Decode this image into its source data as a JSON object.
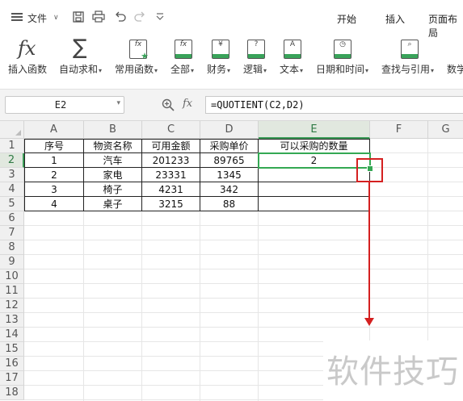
{
  "menubar": {
    "file_label": "文件",
    "tabs": [
      "开始",
      "插入",
      "页面布局"
    ]
  },
  "ribbon": {
    "items": [
      {
        "label": "插入函数",
        "icon": "fx-icon",
        "dropdown": false
      },
      {
        "label": "自动求和",
        "icon": "sigma-icon",
        "dropdown": true
      },
      {
        "label": "常用函数",
        "icon": "star-fx-icon",
        "dropdown": true
      },
      {
        "label": "全部",
        "icon": "fx-book-icon",
        "dropdown": true
      },
      {
        "label": "财务",
        "icon": "yen-book-icon",
        "dropdown": true
      },
      {
        "label": "逻辑",
        "icon": "question-book-icon",
        "dropdown": true
      },
      {
        "label": "文本",
        "icon": "a-book-icon",
        "dropdown": true
      },
      {
        "label": "日期和时间",
        "icon": "clock-book-icon",
        "dropdown": true
      },
      {
        "label": "查找与引用",
        "icon": "search-book-icon",
        "dropdown": true
      },
      {
        "label": "数学",
        "icon": "math-book-icon",
        "dropdown": false
      }
    ]
  },
  "formula_bar": {
    "name_box": "E2",
    "fx_label": "fx",
    "formula": "=QUOTIENT(C2,D2)"
  },
  "sheet": {
    "columns": [
      "A",
      "B",
      "C",
      "D",
      "E",
      "F",
      "G"
    ],
    "selected_column": "E",
    "rows": [
      "1",
      "2",
      "3",
      "4",
      "5",
      "6",
      "7",
      "8",
      "9",
      "10",
      "11",
      "12",
      "13",
      "14",
      "15",
      "16",
      "17",
      "18"
    ],
    "selected_row": "2",
    "headers": [
      "序号",
      "物资名称",
      "可用金额",
      "采购单价",
      "可以采购的数量"
    ],
    "data": [
      [
        "1",
        "汽车",
        "201233",
        "89765",
        "2"
      ],
      [
        "2",
        "家电",
        "23331",
        "1345",
        ""
      ],
      [
        "3",
        "椅子",
        "4231",
        "342",
        ""
      ],
      [
        "4",
        "桌子",
        "3215",
        "88",
        ""
      ]
    ]
  },
  "watermark": "软件技巧",
  "colors": {
    "selection": "#34a853",
    "annotation": "#d42020"
  }
}
